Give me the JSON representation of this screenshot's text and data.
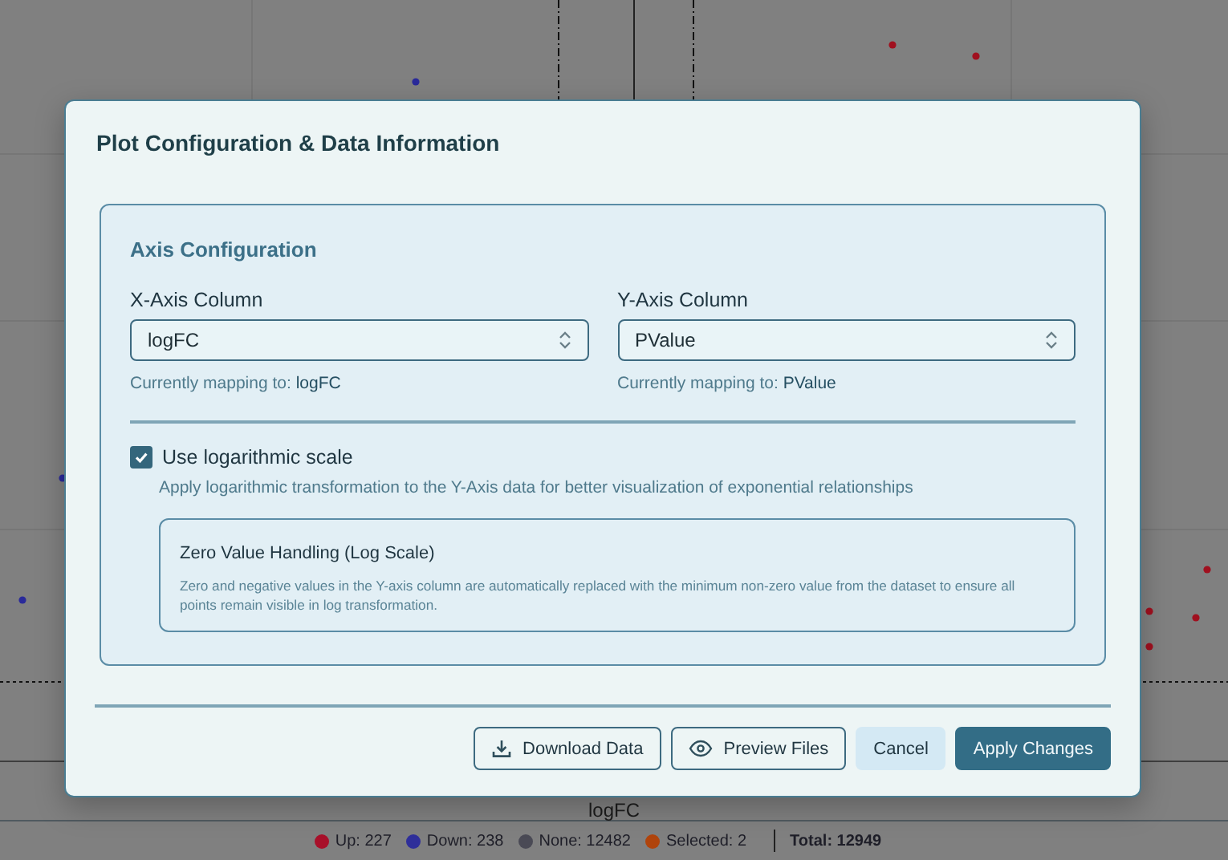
{
  "background": {
    "x_axis_label": "logFC",
    "legend": [
      {
        "label": "Up: 227",
        "color": "#a8102a"
      },
      {
        "label": "Down: 238",
        "color": "#2f2f9a"
      },
      {
        "label": "None: 12482",
        "color": "#4a4a55"
      },
      {
        "label": "Selected: 2",
        "color": "#b0440c"
      }
    ],
    "total": "Total: 12949"
  },
  "dialog": {
    "title": "Plot Configuration & Data Information",
    "section": {
      "title": "Axis Configuration",
      "selects": [
        {
          "label": "X-Axis Column",
          "value": "logFC",
          "mapping_prefix": "Currently mapping to:",
          "mapping_value": "logFC"
        },
        {
          "label": "Y-Axis Column",
          "value": "PValue",
          "mapping_prefix": "Currently mapping to:",
          "mapping_value": "PValue"
        }
      ],
      "log_scale": {
        "label": "Use logarithmic scale",
        "checked": true,
        "description": "Apply logarithmic transformation to the Y-Axis data for better visualization of exponential relationships"
      },
      "note": {
        "title": "Zero Value Handling (Log Scale)",
        "text": "Zero and negative values in the Y-axis column are automatically replaced with the minimum non-zero value from the dataset to ensure all points remain visible in log transformation."
      }
    },
    "buttons": [
      {
        "label": "Download Data",
        "kind": "download"
      },
      {
        "label": "Preview Files",
        "kind": "preview"
      },
      {
        "label": "Cancel",
        "kind": "secondary"
      },
      {
        "label": "Apply Changes",
        "kind": "primary"
      }
    ]
  }
}
